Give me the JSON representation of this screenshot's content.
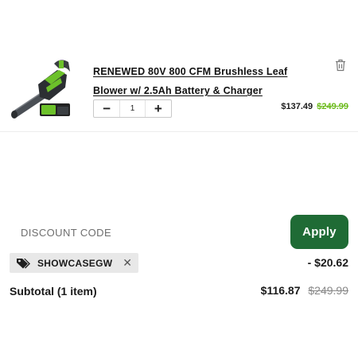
{
  "cart_item": {
    "image": "leaf-blower-product-image",
    "title": "RENEWED 80V 800 CFM Brushless Leaf Blower w/ 2.5Ah Battery & Charger",
    "quantity": "1",
    "decrement_label": "−",
    "increment_label": "+",
    "price": "$137.49",
    "original_price": "$249.99",
    "remove_icon": "trash-icon"
  },
  "discount": {
    "label": "DISCOUNT CODE",
    "apply_label": "Apply",
    "applied_code": "SHOWCASEGW",
    "tag_icon": "tags-icon",
    "remove_label": "✕",
    "amount": "- $20.62"
  },
  "subtotal": {
    "label": "Subtotal (1 item)",
    "value": "$116.87",
    "original_value": "$249.99"
  },
  "colors": {
    "apply_button": "#1f6b35",
    "sale_strike_price": "#6dbb1e",
    "brand_green": "#6cc12a"
  }
}
